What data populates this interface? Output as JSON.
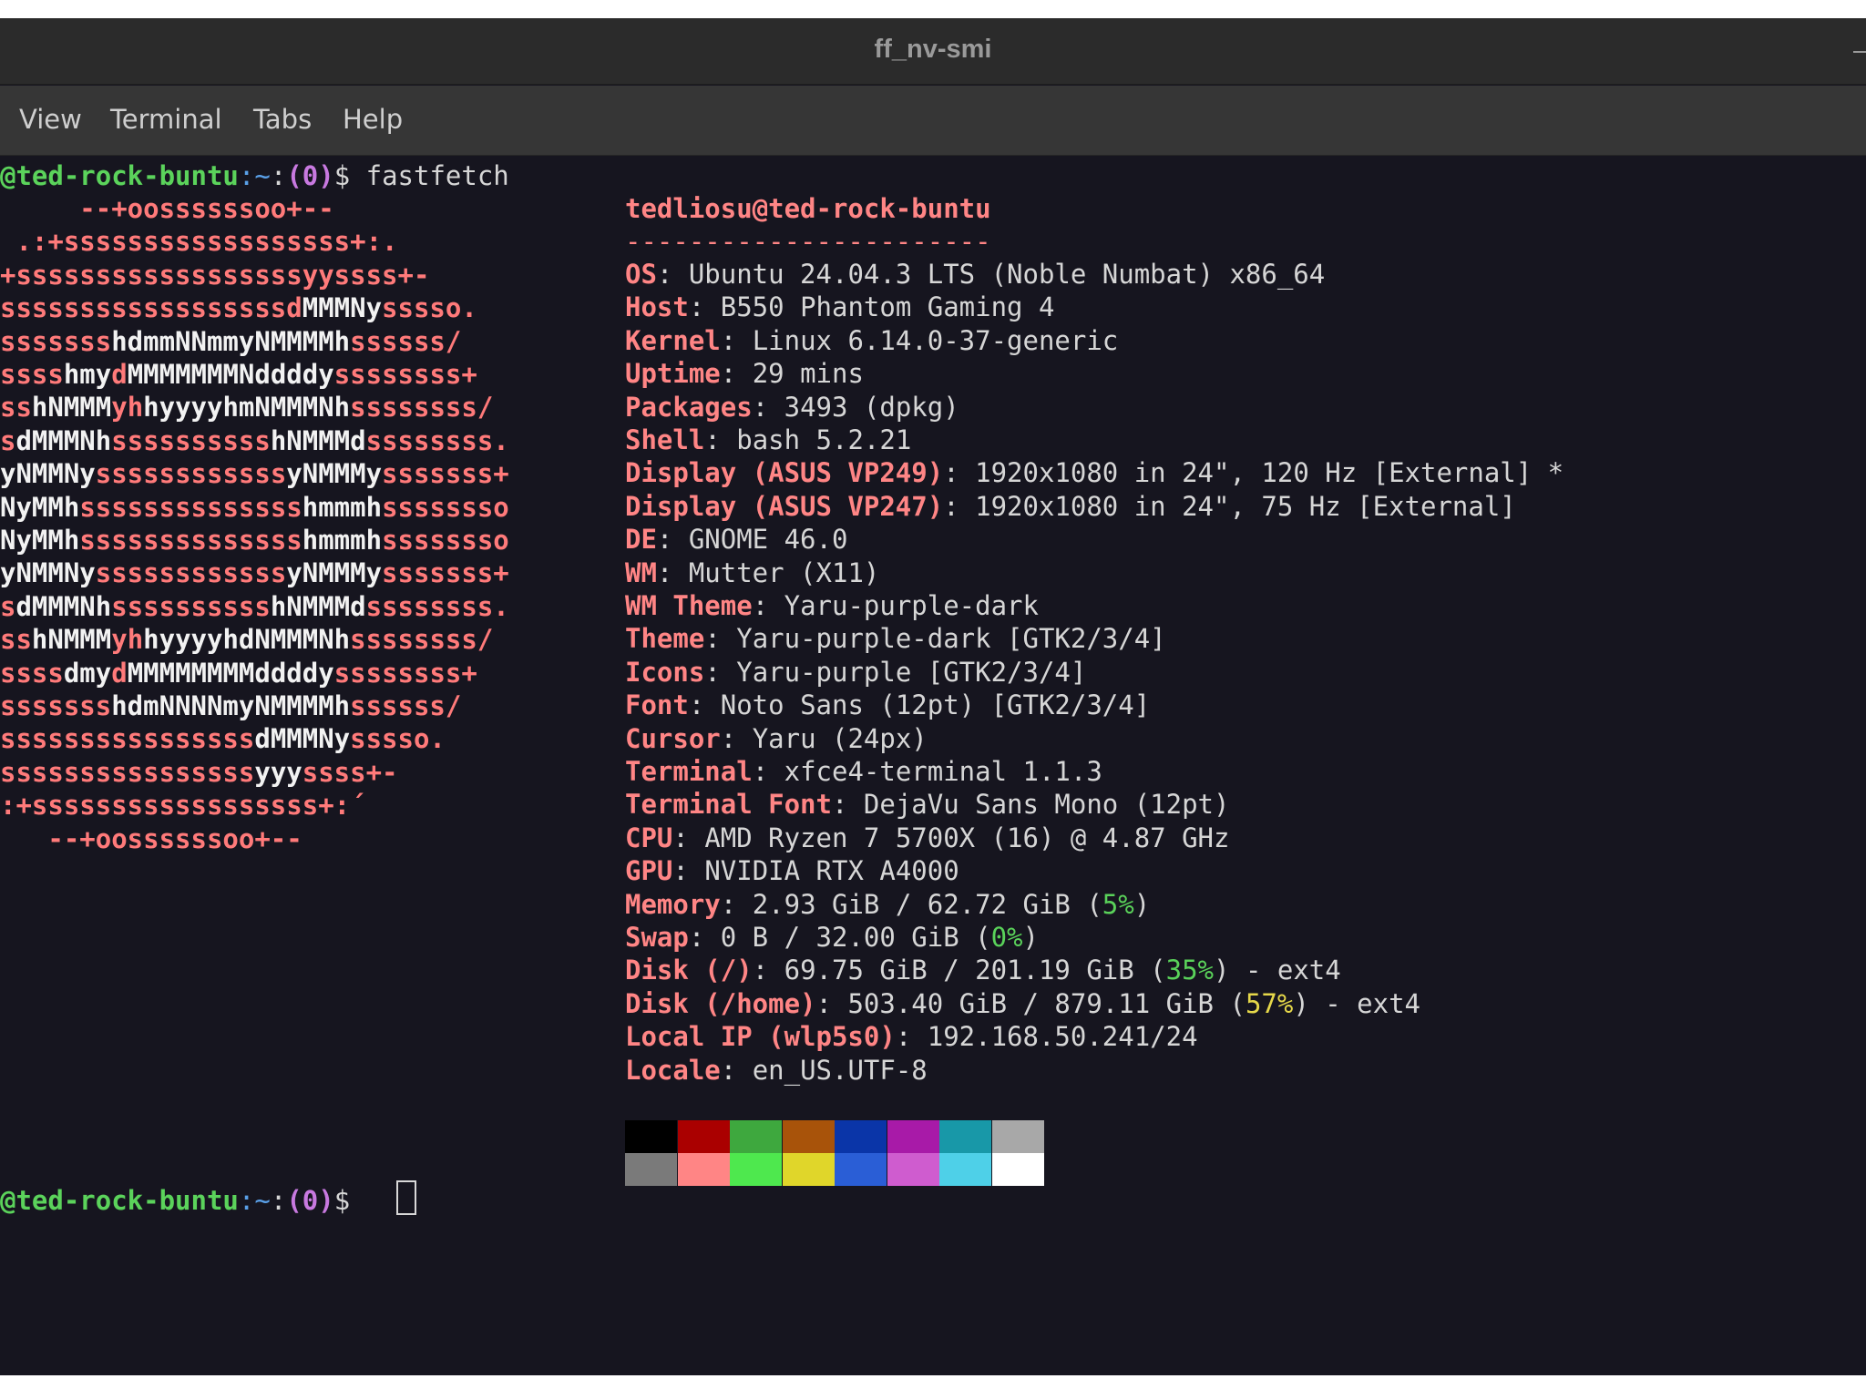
{
  "window": {
    "title": "ff_nv-smi"
  },
  "menu": {
    "items": [
      "View",
      "Terminal",
      "Tabs",
      "Help"
    ]
  },
  "prompt1": {
    "host": "@ted-rock-buntu",
    "colon": ":",
    "tilde": "~",
    "colon2": ":",
    "exit": "(0)",
    "dollar": "$ ",
    "command": "fastfetch"
  },
  "prompt2": {
    "host": "@ted-rock-buntu",
    "colon": ":",
    "tilde": "~",
    "colon2": ":",
    "exit": "(0)",
    "dollar": "$ "
  },
  "logo": [
    [
      [
        "r",
        "     --+oossssssoo+--"
      ]
    ],
    [
      [
        "r",
        " .:+ssssssssssssssssss+:."
      ]
    ],
    [
      [
        "r",
        "+ssssssssssssssssssyyssss+-"
      ]
    ],
    [
      [
        "r",
        "ssssssssssssssssssd"
      ],
      [
        "w",
        "MMMNy"
      ],
      [
        "r",
        "sssso."
      ]
    ],
    [
      [
        "r",
        "sssssss"
      ],
      [
        "w",
        "hdmmNNmmyNMMMMh"
      ],
      [
        "r",
        "ssssss/"
      ]
    ],
    [
      [
        "r",
        "ssss"
      ],
      [
        "w",
        "hmy"
      ],
      [
        "r",
        "d"
      ],
      [
        "w",
        "MMMMMMMNddddy"
      ],
      [
        "r",
        "ssssssss+"
      ]
    ],
    [
      [
        "r",
        "ss"
      ],
      [
        "w",
        "hNMMM"
      ],
      [
        "r",
        "yh"
      ],
      [
        "w",
        "hyyyyhmNMMMNh"
      ],
      [
        "r",
        "ssssssss/"
      ]
    ],
    [
      [
        "r",
        "s"
      ],
      [
        "w",
        "dMMMNh"
      ],
      [
        "r",
        "ssssssssss"
      ],
      [
        "w",
        "hNMMMd"
      ],
      [
        "r",
        "ssssssss."
      ]
    ],
    [
      [
        "w",
        "yNMMNy"
      ],
      [
        "r",
        "ssssssssssss"
      ],
      [
        "w",
        "yNMMMy"
      ],
      [
        "r",
        "sssssss+"
      ]
    ],
    [
      [
        "w",
        "NyMMh"
      ],
      [
        "r",
        "ssssssssssssss"
      ],
      [
        "w",
        "hmmmh"
      ],
      [
        "r",
        "ssssssso"
      ]
    ],
    [
      [
        "w",
        "NyMMh"
      ],
      [
        "r",
        "ssssssssssssss"
      ],
      [
        "w",
        "hmmmh"
      ],
      [
        "r",
        "ssssssso"
      ]
    ],
    [
      [
        "w",
        "yNMMNy"
      ],
      [
        "r",
        "ssssssssssss"
      ],
      [
        "w",
        "yNMMMy"
      ],
      [
        "r",
        "sssssss+"
      ]
    ],
    [
      [
        "r",
        "s"
      ],
      [
        "w",
        "dMMMNh"
      ],
      [
        "r",
        "ssssssssss"
      ],
      [
        "w",
        "hNMMMd"
      ],
      [
        "r",
        "ssssssss."
      ]
    ],
    [
      [
        "r",
        "ss"
      ],
      [
        "w",
        "hNMMM"
      ],
      [
        "r",
        "yh"
      ],
      [
        "w",
        "hyyyyhdNMMMNh"
      ],
      [
        "r",
        "ssssssss/"
      ]
    ],
    [
      [
        "r",
        "ssss"
      ],
      [
        "w",
        "dmy"
      ],
      [
        "r",
        "d"
      ],
      [
        "w",
        "MMMMMMMMddddy"
      ],
      [
        "r",
        "ssssssss+"
      ]
    ],
    [
      [
        "r",
        "sssssss"
      ],
      [
        "w",
        "hdmNNNNmyNMMMMh"
      ],
      [
        "r",
        "ssssss/"
      ]
    ],
    [
      [
        "r",
        "ssssssssssssssss"
      ],
      [
        "w",
        "dMMMNy"
      ],
      [
        "r",
        "sssso."
      ]
    ],
    [
      [
        "r",
        "ssssssssssssssss"
      ],
      [
        "w",
        "yyy"
      ],
      [
        "r",
        "ssss+-"
      ]
    ],
    [
      [
        "r",
        ":+ssssssssssssssssss+:´"
      ]
    ],
    [
      [
        "r",
        "   --+oossssssoo+--"
      ]
    ]
  ],
  "info": {
    "userhost": "tedliosu@ted-rock-buntu",
    "separator": "-----------------------",
    "rows": [
      {
        "key": "OS",
        "value": "Ubuntu 24.04.3 LTS (Noble Numbat) x86_64"
      },
      {
        "key": "Host",
        "value": "B550 Phantom Gaming 4"
      },
      {
        "key": "Kernel",
        "value": "Linux 6.14.0-37-generic"
      },
      {
        "key": "Uptime",
        "value": "29 mins"
      },
      {
        "key": "Packages",
        "value": "3493 (dpkg)"
      },
      {
        "key": "Shell",
        "value": "bash 5.2.21"
      },
      {
        "key": "Display (ASUS VP249)",
        "value": "1920x1080 in 24\", 120 Hz [External] *"
      },
      {
        "key": "Display (ASUS VP247)",
        "value": "1920x1080 in 24\", 75 Hz [External]"
      },
      {
        "key": "DE",
        "value": "GNOME 46.0"
      },
      {
        "key": "WM",
        "value": "Mutter (X11)"
      },
      {
        "key": "WM Theme",
        "value": "Yaru-purple-dark"
      },
      {
        "key": "Theme",
        "value": "Yaru-purple-dark [GTK2/3/4]"
      },
      {
        "key": "Icons",
        "value": "Yaru-purple [GTK2/3/4]"
      },
      {
        "key": "Font",
        "value": "Noto Sans (12pt) [GTK2/3/4]"
      },
      {
        "key": "Cursor",
        "value": "Yaru (24px)"
      },
      {
        "key": "Terminal",
        "value": "xfce4-terminal 1.1.3"
      },
      {
        "key": "Terminal Font",
        "value": "DejaVu Sans Mono (12pt)"
      },
      {
        "key": "CPU",
        "value": "AMD Ryzen 7 5700X (16) @ 4.87 GHz"
      },
      {
        "key": "GPU",
        "value": "NVIDIA RTX A4000"
      },
      {
        "key": "Memory",
        "pre": "2.93 GiB / 62.72 GiB (",
        "pct": "5%",
        "pct_color": "green",
        "post": ")"
      },
      {
        "key": "Swap",
        "pre": "0 B / 32.00 GiB (",
        "pct": "0%",
        "pct_color": "green",
        "post": ")"
      },
      {
        "key": "Disk (/)",
        "pre": "69.75 GiB / 201.19 GiB (",
        "pct": "35%",
        "pct_color": "green",
        "post": ") - ext4"
      },
      {
        "key": "Disk (/home)",
        "pre": "503.40 GiB / 879.11 GiB (",
        "pct": "57%",
        "pct_color": "yellow",
        "post": ") - ext4"
      },
      {
        "key": "Local IP (wlp5s0)",
        "value": "192.168.50.241/24"
      },
      {
        "key": "Locale",
        "value": "en_US.UTF-8"
      }
    ]
  },
  "palette": {
    "row1": [
      "#000000",
      "#aa0000",
      "#3ea83e",
      "#a8530a",
      "#0a35a8",
      "#a81aa8",
      "#1898a8",
      "#a8a8a8"
    ],
    "row2": [
      "#7a7a7a",
      "#ff8585",
      "#4ee84e",
      "#e0d62a",
      "#2a5ed6",
      "#cf5ccf",
      "#4ed0e8",
      "#ffffff"
    ]
  }
}
